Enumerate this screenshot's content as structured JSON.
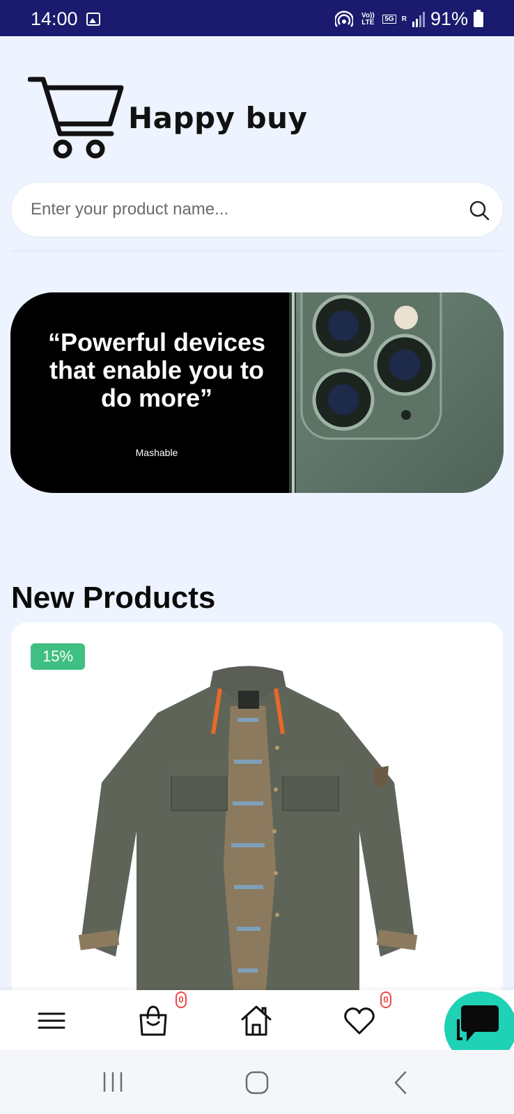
{
  "status_bar": {
    "time": "14:00",
    "volte": "Vo)) LTE",
    "network": "5G",
    "roaming": "R",
    "battery": "91%"
  },
  "app": {
    "brand": "Happy buy"
  },
  "search": {
    "placeholder": "Enter your product name..."
  },
  "banner": {
    "quote": "“Powerful devices that enable you to do more”",
    "source": "Mashable"
  },
  "new_products": {
    "title": "New Products",
    "items": [
      {
        "discount": "15%",
        "image": "olive-canvas-shirt-jacket"
      }
    ]
  },
  "bottom_nav": {
    "cart_count": "0",
    "wishlist_count": "0",
    "icons": [
      "menu-icon",
      "shopping-bag-icon",
      "home-icon",
      "heart-icon",
      "chat-icon"
    ]
  },
  "colors": {
    "status_bar": "#1A1A6E",
    "background": "#EDF3FF",
    "discount": "#3FBF82",
    "chat_fab": "#1FD1B5",
    "badge": "#F04848"
  }
}
